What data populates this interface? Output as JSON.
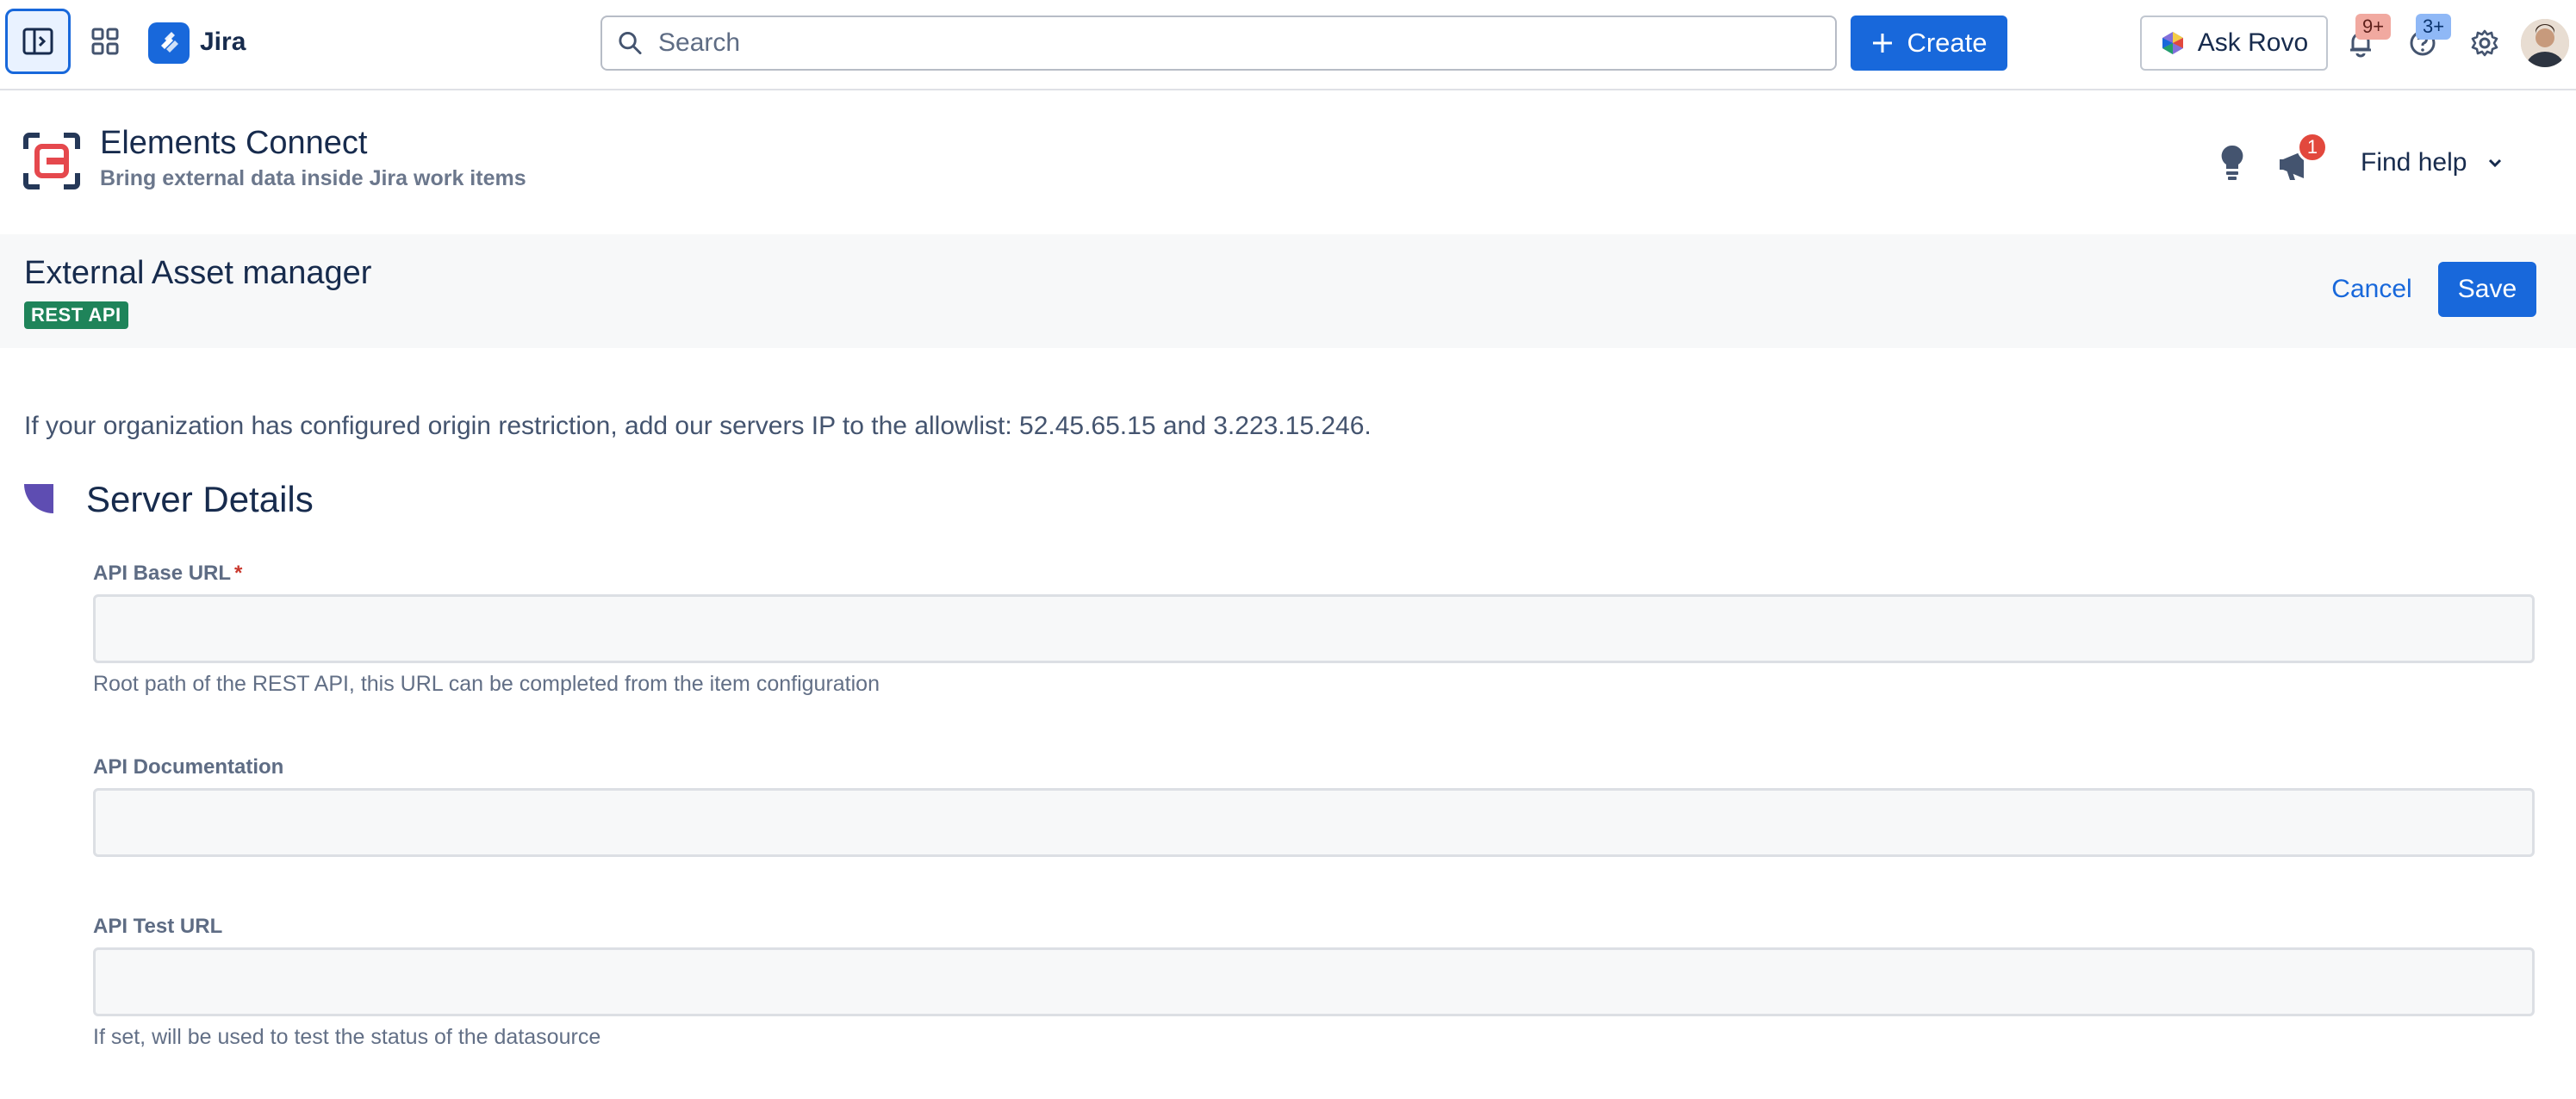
{
  "topnav": {
    "app_name": "Jira",
    "search_placeholder": "Search",
    "create_label": "Create",
    "ask_rovo_label": "Ask Rovo",
    "notifications_badge": "9+",
    "help_badge": "3+"
  },
  "app_header": {
    "title": "Elements Connect",
    "subtitle": "Bring external data inside Jira work items",
    "announcement_badge": "1",
    "find_help_label": "Find help"
  },
  "page": {
    "title": "External Asset manager",
    "lozenge": "REST API",
    "cancel_label": "Cancel",
    "save_label": "Save"
  },
  "content": {
    "notice": "If your organization has configured origin restriction, add our servers IP to the allowlist: 52.45.65.15 and 3.223.15.246.",
    "section_title": "Server Details",
    "fields": [
      {
        "label": "API Base URL",
        "required_marker": "*",
        "value": "",
        "helper": "Root path of the REST API, this URL can be completed from the item configuration"
      },
      {
        "label": "API Documentation",
        "value": "",
        "helper": ""
      },
      {
        "label": "API Test URL",
        "value": "",
        "helper": "If set, will be used to test the status of the datasource"
      }
    ]
  },
  "colors": {
    "brand_blue": "#1868db",
    "lozenge_green": "#1f845a",
    "notification_badge_red": "#f1a9a0",
    "help_badge_blue": "#8fb8f6",
    "announcement_red": "#e2483d",
    "required_red": "#c9372c",
    "section_icon_purple": "#5e4db2"
  }
}
